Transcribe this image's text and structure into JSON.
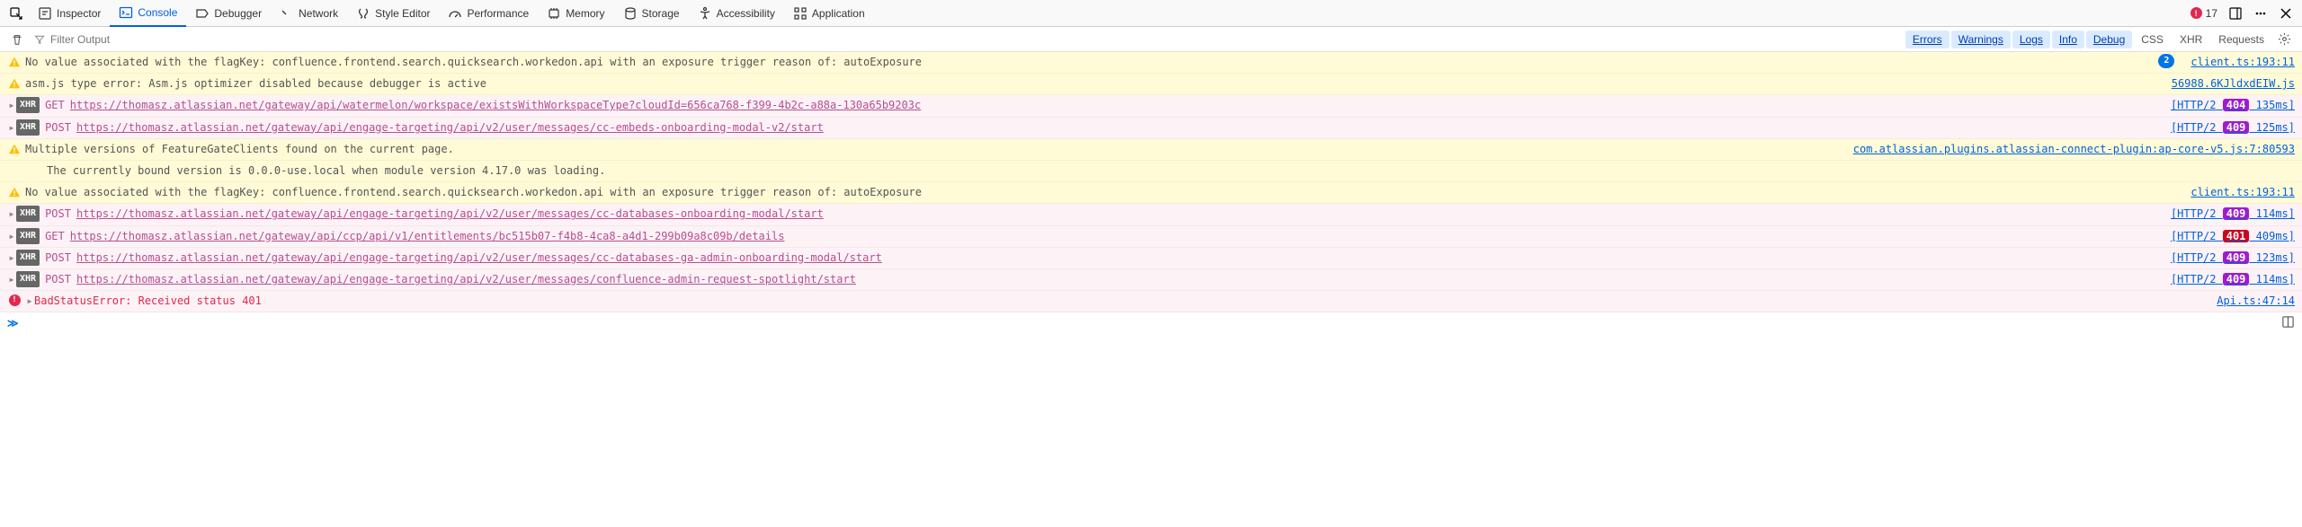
{
  "toolbar": {
    "inspector": "Inspector",
    "console": "Console",
    "debugger": "Debugger",
    "network": "Network",
    "style_editor": "Style Editor",
    "performance": "Performance",
    "memory": "Memory",
    "storage": "Storage",
    "accessibility": "Accessibility",
    "application": "Application",
    "error_count": "17"
  },
  "filter": {
    "placeholder": "Filter Output",
    "errors": "Errors",
    "warnings": "Warnings",
    "logs": "Logs",
    "info": "Info",
    "debug": "Debug",
    "css": "CSS",
    "xhr": "XHR",
    "requests": "Requests"
  },
  "rows": [
    {
      "type": "warn",
      "msg": "No value associated with the flagKey: confluence.frontend.search.quicksearch.workedon.api with an exposure trigger reason of: autoExposure",
      "count": "2",
      "source": "client.ts:193:11"
    },
    {
      "type": "warn",
      "msg": "asm.js type error: Asm.js optimizer disabled because debugger is active",
      "source": "56988.6KJldxdEIW.js"
    },
    {
      "type": "xhr-err",
      "method": "GET",
      "url": "https://thomasz.atlassian.net/gateway/api/watermelon/workspace/existsWithWorkspaceType?cloudId=656ca768-f399-4b2c-a88a-130a65b9203c",
      "status_prefix": "[HTTP/2 ",
      "status": "404",
      "status_suffix": "  135ms]"
    },
    {
      "type": "xhr-err",
      "method": "POST",
      "url": "https://thomasz.atlassian.net/gateway/api/engage-targeting/api/v2/user/messages/cc-embeds-onboarding-modal-v2/start",
      "status_prefix": "[HTTP/2 ",
      "status": "409",
      "status_suffix": "  125ms]"
    },
    {
      "type": "warn",
      "msg": "Multiple versions of FeatureGateClients found on the current page.",
      "sub": "The currently bound version is 0.0.0-use.local when module version 4.17.0 was loading.",
      "source": "com.atlassian.plugins.atlassian-connect-plugin:ap-core-v5.js:7:80593"
    },
    {
      "type": "warn",
      "msg": "No value associated with the flagKey: confluence.frontend.search.quicksearch.workedon.api with an exposure trigger reason of: autoExposure",
      "source": "client.ts:193:11"
    },
    {
      "type": "xhr-err",
      "method": "POST",
      "url": "https://thomasz.atlassian.net/gateway/api/engage-targeting/api/v2/user/messages/cc-databases-onboarding-modal/start",
      "status_prefix": "[HTTP/2 ",
      "status": "409",
      "status_suffix": "  114ms]"
    },
    {
      "type": "xhr-err",
      "method": "GET",
      "url": "https://thomasz.atlassian.net/gateway/api/ccp/api/v1/entitlements/bc515b07-f4b8-4ca8-a4d1-299b09a8c09b/details",
      "status_prefix": "[HTTP/2 ",
      "status": "401",
      "status_suffix": "  409ms]"
    },
    {
      "type": "xhr-err",
      "method": "POST",
      "url": "https://thomasz.atlassian.net/gateway/api/engage-targeting/api/v2/user/messages/cc-databases-ga-admin-onboarding-modal/start",
      "status_prefix": "[HTTP/2 ",
      "status": "409",
      "status_suffix": "  123ms]"
    },
    {
      "type": "xhr-err",
      "method": "POST",
      "url": "https://thomasz.atlassian.net/gateway/api/engage-targeting/api/v2/user/messages/confluence-admin-request-spotlight/start",
      "status_prefix": "[HTTP/2 ",
      "status": "409",
      "status_suffix": "  114ms]"
    },
    {
      "type": "err",
      "msg": "BadStatusError: Received status 401",
      "source": "Api.ts:47:14"
    }
  ]
}
